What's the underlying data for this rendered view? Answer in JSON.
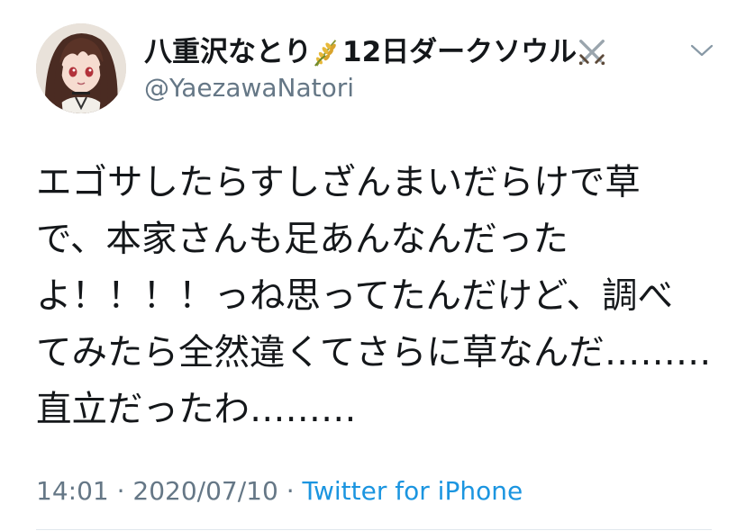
{
  "tweet": {
    "display_name_part1": "八重沢なとり",
    "display_name_part2": "12日ダークソウル",
    "name_emoji_1": "rice-ear-icon",
    "name_emoji_2": "crossed-swords-icon",
    "handle": "@YaezawaNatori",
    "body_lines": [
      "エゴサしたらすしざんまいだらけで草",
      "で、本家さんも足あんなんだった",
      "よ！！！！っね思ってたんだけど、調べ",
      "てみたら全然違くてさらに草なんだ………",
      "直立だったわ………"
    ],
    "time": "14:01",
    "separator": "·",
    "date": "2020/07/10",
    "source": "Twitter for iPhone"
  },
  "colors": {
    "text": "#14171a",
    "secondary": "#657786",
    "link": "#1b95e0",
    "divider": "#e1e8ed"
  }
}
